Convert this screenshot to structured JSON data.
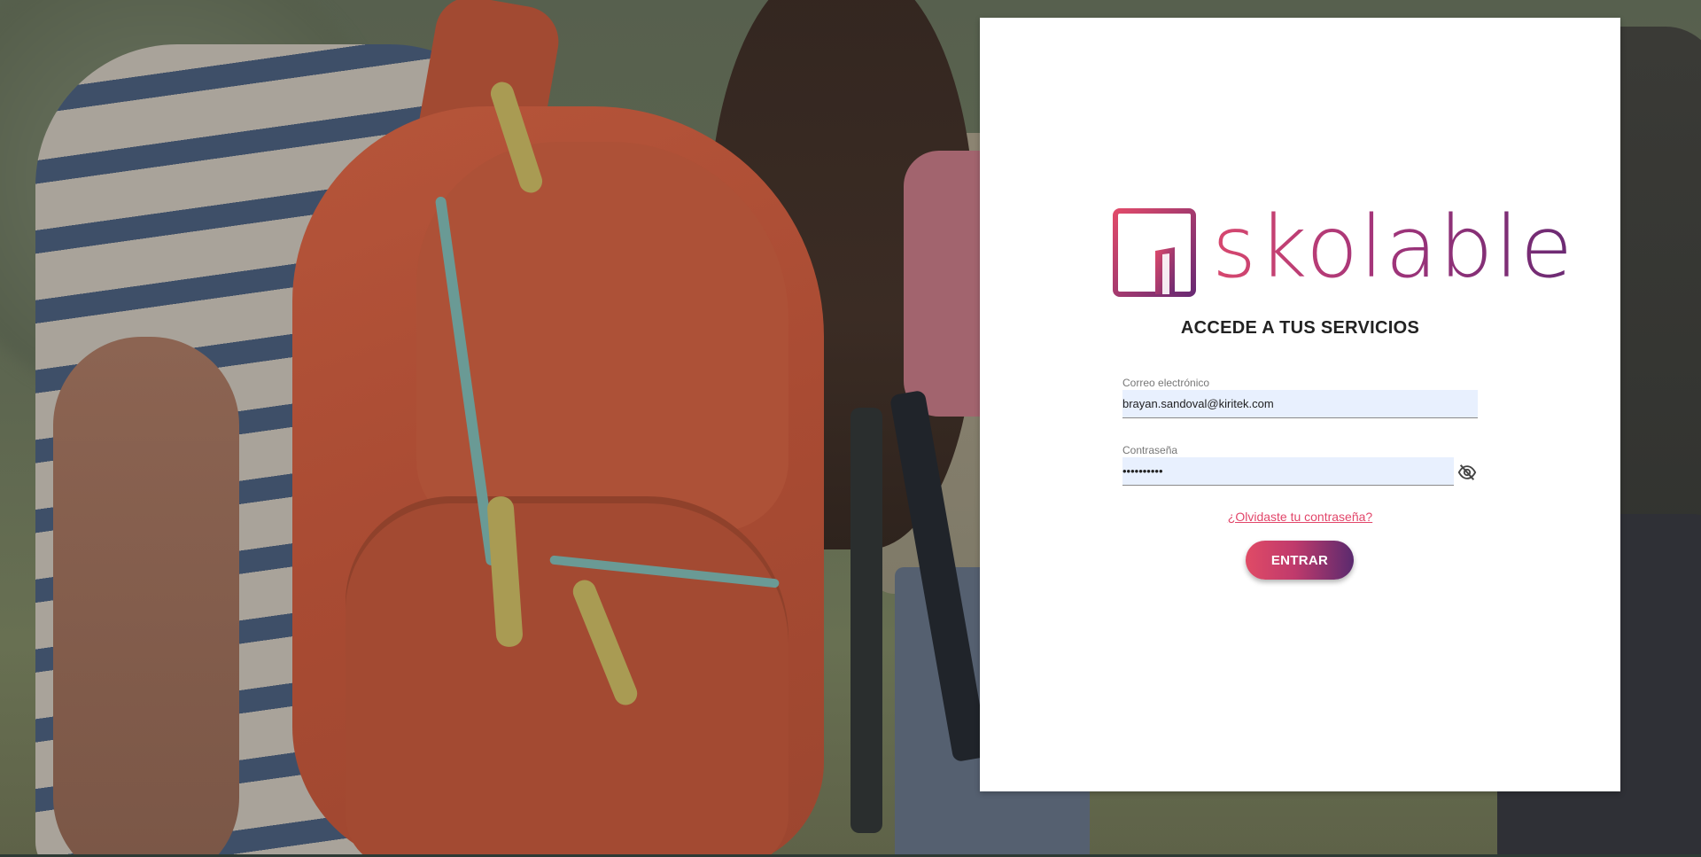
{
  "brand": {
    "logo_text": "skolable",
    "gradient_start": "#d8486e",
    "gradient_end": "#6a2a73"
  },
  "login": {
    "title": "ACCEDE A TUS SERVICIOS",
    "email_label": "Correo electrónico",
    "email_value": "brayan.sandoval@kiritek.com",
    "password_label": "Contraseña",
    "password_value": "••••••••••",
    "password_visibility_icon": "eye-off-icon",
    "forgot_link": "¿Olvidaste tu contraseña?",
    "submit_label": "ENTRAR"
  },
  "colors": {
    "link": "#e2466a",
    "field_background": "#e8f0fe",
    "card_background": "#ffffff"
  }
}
